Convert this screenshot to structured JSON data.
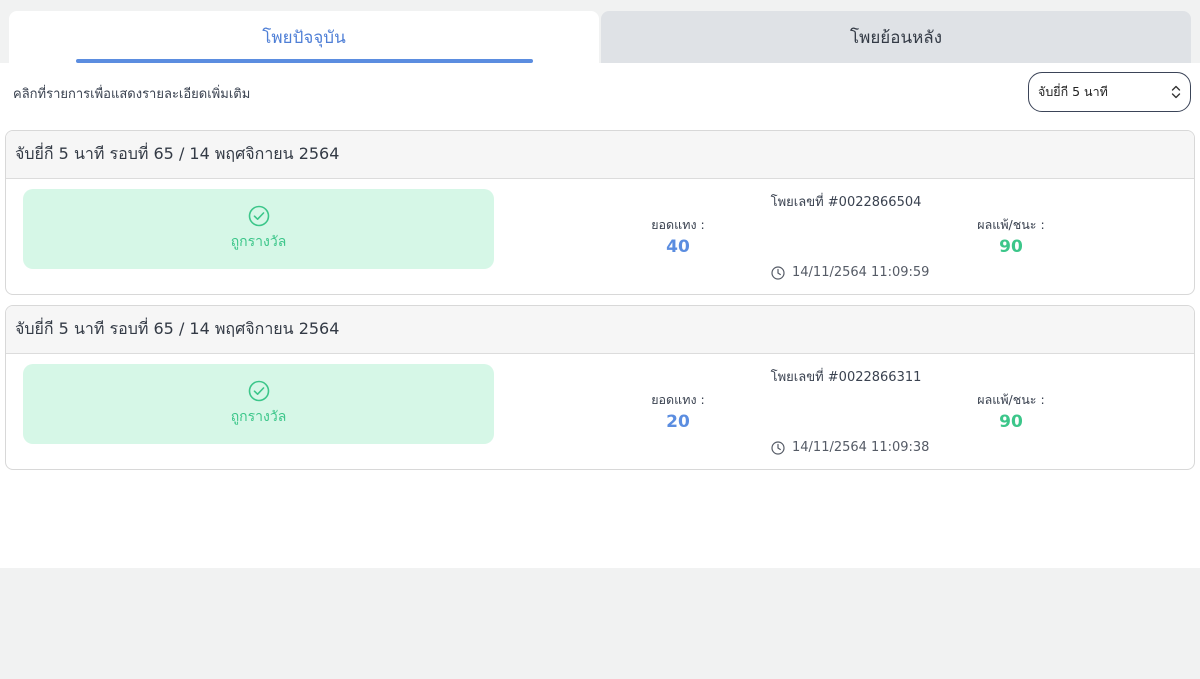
{
  "tabs": [
    {
      "label": "โพยปัจจุบัน",
      "active": true
    },
    {
      "label": "โพยย้อนหลัง",
      "active": false
    }
  ],
  "hint": "คลิกที่รายการเพื่อแสดงรายละเอียดเพิ่มเติม",
  "filter": {
    "selected": "จับยี่กี 5 นาที"
  },
  "colors": {
    "accent": "#5b8de0",
    "win": "#3cc68a",
    "win_bg": "#d6f7e7"
  },
  "tickets": [
    {
      "header": "จับยี่กี 5 นาที รอบที่ 65 / 14 พฤศจิกายน 2564",
      "status": "ถูกรางวัล",
      "status_icon": "check-circle-icon",
      "ticket_no": "โพยเลขที่ #0022866504",
      "bet_label": "ยอดแทง :",
      "bet_value": "40",
      "win_label": "ผลแพ้/ชนะ :",
      "win_value": "90",
      "time": "14/11/2564 11:09:59"
    },
    {
      "header": "จับยี่กี 5 นาที รอบที่ 65 / 14 พฤศจิกายน 2564",
      "status": "ถูกรางวัล",
      "status_icon": "check-circle-icon",
      "ticket_no": "โพยเลขที่ #0022866311",
      "bet_label": "ยอดแทง :",
      "bet_value": "20",
      "win_label": "ผลแพ้/ชนะ :",
      "win_value": "90",
      "time": "14/11/2564 11:09:38"
    }
  ]
}
